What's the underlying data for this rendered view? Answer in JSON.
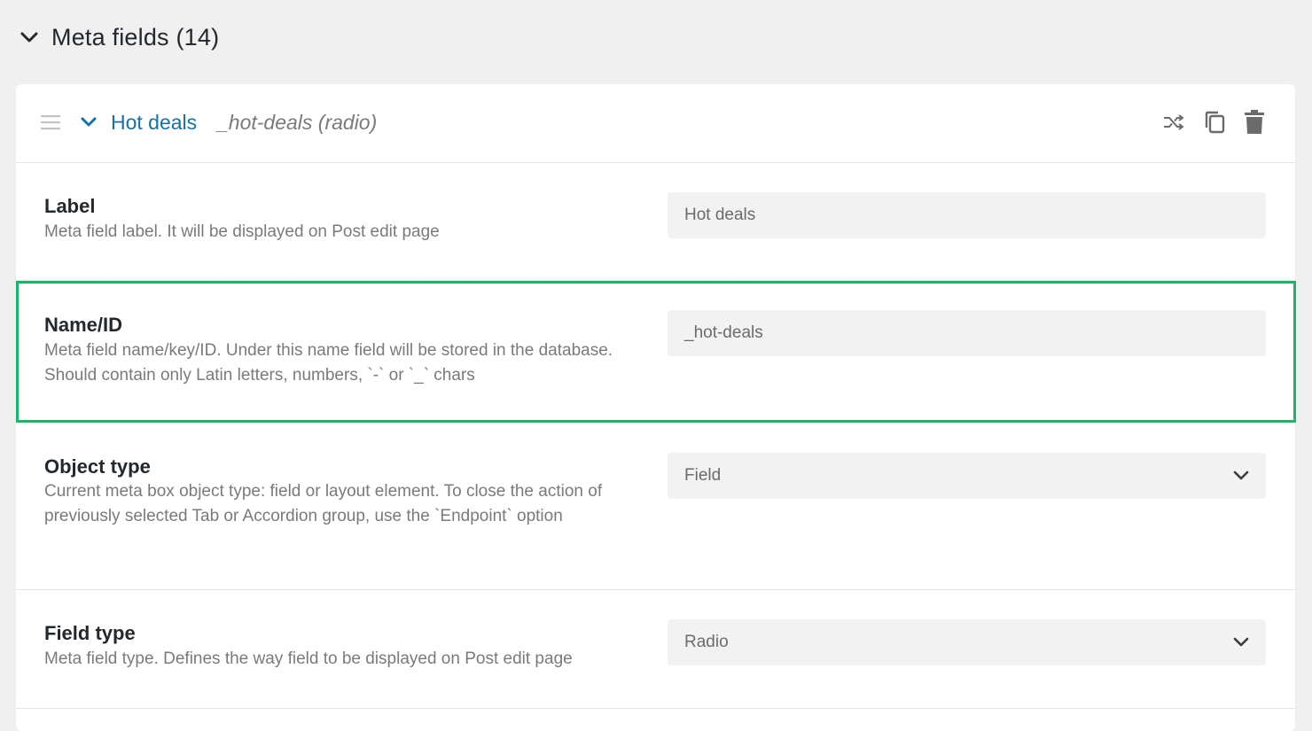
{
  "section": {
    "title": "Meta fields (14)",
    "chevron_icon": "chevron-down-icon"
  },
  "field": {
    "label": "Hot deals",
    "meta": "_hot-deals (radio)",
    "actions": [
      "shuffle-icon",
      "copy-icon",
      "trash-icon"
    ]
  },
  "rows": {
    "label": {
      "title": "Label",
      "description": "Meta field label. It will be displayed on Post edit page",
      "value": "Hot deals"
    },
    "name_id": {
      "title": "Name/ID",
      "description": "Meta field name/key/ID. Under this name field will be stored in the database. Should contain only Latin letters, numbers, `-` or `_` chars",
      "value": "_hot-deals"
    },
    "object_type": {
      "title": "Object type",
      "description": "Current meta box object type: field or layout element. To close the action of previously selected Tab or Accordion group, use the `Endpoint` option",
      "value": "Field"
    },
    "field_type": {
      "title": "Field type",
      "description": "Meta field type. Defines the way field to be displayed on Post edit page",
      "value": "Radio"
    }
  },
  "colors": {
    "accent_link": "#1572a8",
    "highlight_border": "#1db56a",
    "background": "#f0f0f1"
  }
}
